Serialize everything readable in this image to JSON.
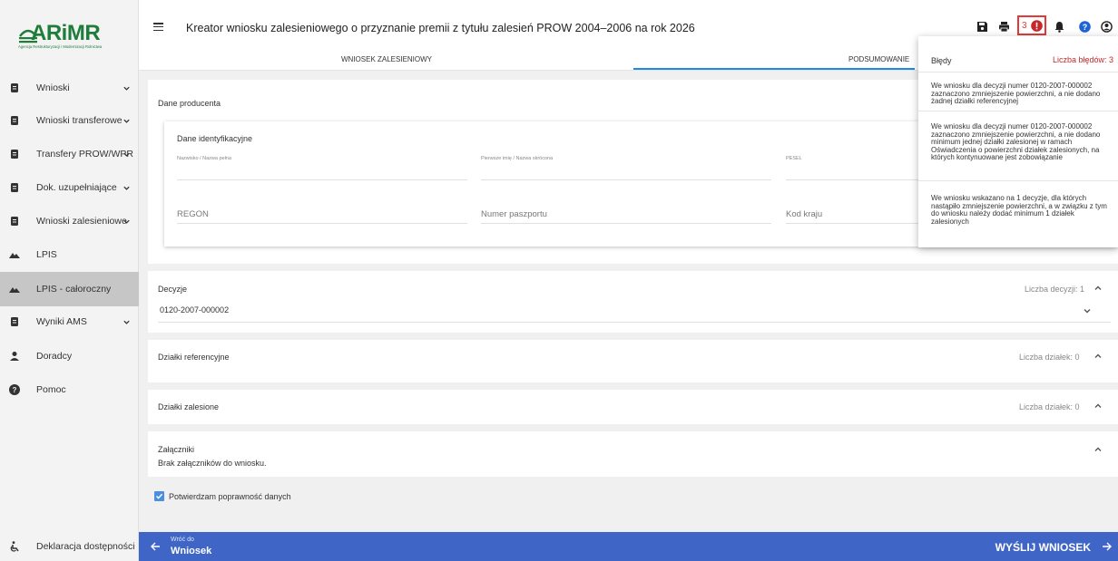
{
  "logo": {
    "name": "ARiMR",
    "subtitle": "Agencja Restrukturyzacji i Modernizacji Rolnictwa"
  },
  "sidebar": {
    "items": [
      {
        "label": "Wnioski",
        "icon": "document-icon",
        "has_chevron": true,
        "active": false
      },
      {
        "label": "Wnioski transferowe",
        "icon": "document-icon",
        "has_chevron": true,
        "active": false
      },
      {
        "label": "Transfery PROW/WPR",
        "icon": "document-icon",
        "has_chevron": true,
        "active": false
      },
      {
        "label": "Dok. uzupełniające",
        "icon": "document-icon",
        "has_chevron": true,
        "active": false
      },
      {
        "label": "Wnioski zalesieniowe",
        "icon": "document-icon",
        "has_chevron": true,
        "active": false
      },
      {
        "label": "LPIS",
        "icon": "mountain-icon",
        "has_chevron": false,
        "active": false
      },
      {
        "label": "LPIS - całoroczny",
        "icon": "mountain-icon",
        "has_chevron": false,
        "active": true
      },
      {
        "label": "Wyniki AMS",
        "icon": "document-icon",
        "has_chevron": true,
        "active": false
      },
      {
        "label": "Doradcy",
        "icon": "person-icon",
        "has_chevron": false,
        "active": false
      },
      {
        "label": "Pomoc",
        "icon": "help-icon",
        "has_chevron": false,
        "active": false
      }
    ],
    "accessibility_label": "Deklaracja dostępności"
  },
  "header": {
    "title": "Kreator wniosku zalesieniowego o przyznanie premii z tytułu zalesień PROW 2004–2006 na rok 2026",
    "error_count": "3"
  },
  "tabs": {
    "form": "WNIOSEK ZALESIENIOWY",
    "summary": "PODSUMOWANIE"
  },
  "producer": {
    "section_title": "Dane producenta",
    "ident_title": "Dane identyfikacyjne",
    "surname_label": "Nazwisko / Nazwa pełna",
    "firstname_label": "Pierwsze imię / Nazwa skrócona",
    "pesel_label": "PESEL",
    "regon_placeholder": "REGON",
    "passport_placeholder": "Numer paszportu",
    "country_placeholder": "Kod kraju"
  },
  "decisions": {
    "title": "Decyzje",
    "count_label": "Liczba decyzji: 1",
    "selected": "0120-2007-000002"
  },
  "ref_plots": {
    "title": "Działki referencyjne",
    "count_label": "Liczba działek: 0"
  },
  "forest_plots": {
    "title": "Działki zalesione",
    "count_label": "Liczba działek: 0"
  },
  "attachments": {
    "title": "Załączniki",
    "empty_text": "Brak załączników do wniosku."
  },
  "confirm": {
    "label": "Potwierdzam poprawność danych",
    "checked": true
  },
  "bottom": {
    "back_small": "Wróć do",
    "back_big": "Wniosek",
    "send_label": "WYŚLIJ WNIOSEK"
  },
  "errors": {
    "title": "Błędy",
    "count_label": "Liczba błędów: 3",
    "items": [
      "We wniosku dla decyzji numer 0120-2007-000002 zaznaczono zmniejszenie powierzchni, a nie dodano żadnej działki referencyjnej",
      "We wniosku dla decyzji numer 0120-2007-000002 zaznaczono zmniejszenie powierzchni, a nie dodano minimum jednej działki zalesionej w ramach Oświadczenia o powierzchni działek zalesionych, na których kontynuowane jest zobowiązanie",
      "We wniosku wskazano na 1 decyzje, dla których nastąpiło zmniejszenie powierzchni, a w związku z tym do wniosku należy dodać minimum 1 działek zalesionych"
    ]
  },
  "colors": {
    "brand": "#1e7d3a",
    "accent": "#1e88e5",
    "bottom_bar": "#3f66c6",
    "error": "#e53935"
  }
}
